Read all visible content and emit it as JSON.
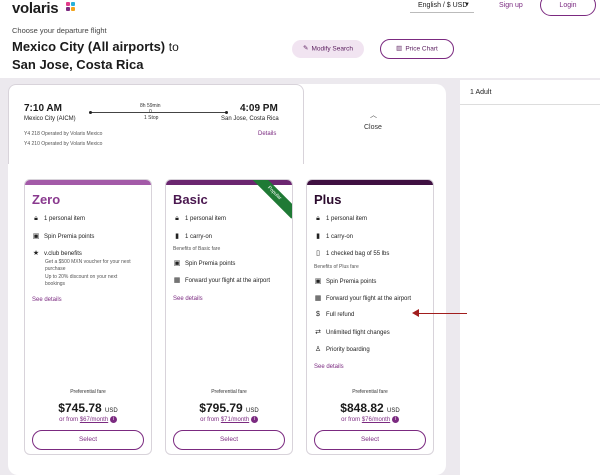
{
  "colors": {
    "brand": "#7b2a80",
    "zero": "#a35aa8",
    "basic": "#6b2670",
    "plus": "#3f1041",
    "popular": "#1f7a35",
    "arrow": "#a11d1d"
  },
  "header": {
    "logo": "volaris",
    "language": "English / $ USD",
    "signup": "Sign up",
    "login": "Login"
  },
  "search": {
    "choose_label": "Choose your departure flight",
    "origin": "Mexico City (All airports)",
    "to": "to",
    "destination": "San Jose, Costa Rica",
    "modify_label": "Modify Search",
    "price_chart_label": "Price Chart"
  },
  "flight": {
    "dep_time": "7:10 AM",
    "dep_place": "Mexico City (AICM)",
    "duration": "8h 59min",
    "stops": "1 Stop",
    "stop_dots": "0",
    "arr_time": "4:09 PM",
    "arr_place": "San Jose, Costa Rica",
    "operator1": "Y4 218 Operated by Volaris Mexico",
    "operator2": "Y4 210 Operated by Volaris Mexico",
    "details_label": "Details",
    "close_label": "Close"
  },
  "side": {
    "passengers": "1 Adult"
  },
  "fares": [
    {
      "name": "Zero",
      "features": [
        "1 personal item",
        "Spin Premia points",
        "v.club benefits"
      ],
      "vclub_notes": [
        "Get a $500 MXN voucher for your next",
        "purchase",
        "Up to 20% discount  on your next",
        "bookings"
      ],
      "see_details": "See details",
      "preferential": "Preferential fare",
      "price": "$745.78",
      "currency": "USD",
      "or_from": "or from",
      "monthly": "$67/month",
      "select": "Select"
    },
    {
      "name": "Basic",
      "badge": "Popular",
      "features": [
        "1 personal item",
        "1 carry-on",
        "Spin Premia points",
        "Forward your flight at the airport"
      ],
      "benefits_label": "Benefits of Basic fare",
      "see_details": "See details",
      "preferential": "Preferential fare",
      "price": "$795.79",
      "currency": "USD",
      "or_from": "or from",
      "monthly": "$71/month",
      "select": "Select"
    },
    {
      "name": "Plus",
      "features": [
        "1 personal item",
        "1 carry-on",
        "1 checked bag of 55 lbs",
        "Spin Premia points",
        "Forward your flight at the airport",
        "Full refund",
        "Unlimited flight changes",
        "Priority boarding"
      ],
      "benefits_label": "Benefits of Plus fare",
      "see_details": "See details",
      "preferential": "Preferential fare",
      "price": "$848.82",
      "currency": "USD",
      "or_from": "or from",
      "monthly": "$76/month",
      "select": "Select"
    }
  ]
}
